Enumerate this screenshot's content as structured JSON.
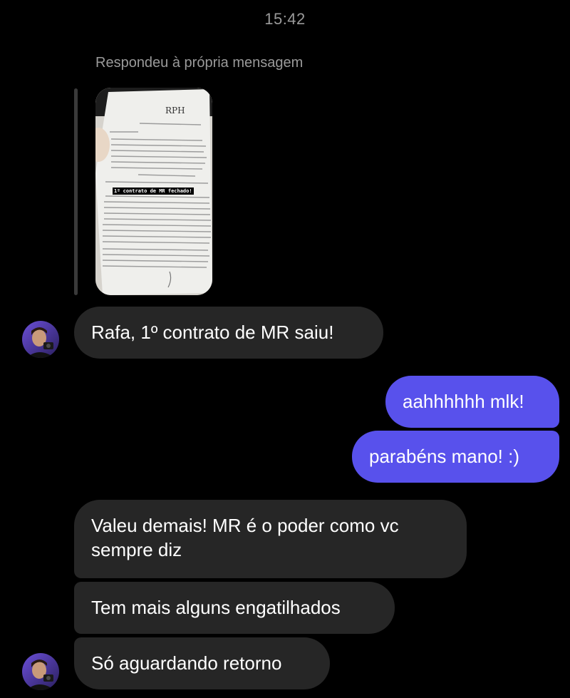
{
  "timestamp": "15:42",
  "reply_label": "Respondeu à própria mensagem",
  "story": {
    "caption": "1º contrato de MR fechado!",
    "logo_text": "RPH"
  },
  "messages": [
    {
      "side": "in",
      "text": "Rafa, 1º contrato de MR saiu!"
    },
    {
      "side": "out",
      "text": "aahhhhhh mlk!"
    },
    {
      "side": "out",
      "text": "parabéns mano! :)"
    },
    {
      "side": "in",
      "text": "Valeu demais! MR é o poder como vc sempre diz"
    },
    {
      "side": "in",
      "text": "Tem mais alguns engatilhados"
    },
    {
      "side": "in",
      "text": "Só aguardando retorno"
    }
  ],
  "colors": {
    "background": "#000000",
    "incoming_bubble": "#262626",
    "outgoing_bubble": "#5851ec",
    "meta_text": "#9a9a9a"
  }
}
